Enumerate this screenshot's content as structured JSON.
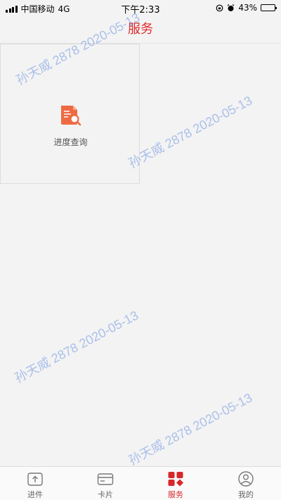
{
  "status_bar": {
    "carrier": "中国移动",
    "network": "4G",
    "time": "下午2:33",
    "battery": "43%",
    "battery_level": 0.43
  },
  "header": {
    "title": "服务"
  },
  "services": [
    {
      "label": "进度查询",
      "icon": "progress-search-icon"
    }
  ],
  "watermark": {
    "text": "孙天威 2878 2020-05-13"
  },
  "tabbar": {
    "tabs": [
      {
        "label": "进件",
        "icon": "upload-box-icon"
      },
      {
        "label": "卡片",
        "icon": "card-icon"
      },
      {
        "label": "服务",
        "icon": "grid-diamond-icon",
        "active": true
      },
      {
        "label": "我的",
        "icon": "user-circle-icon"
      }
    ]
  },
  "colors": {
    "accent": "#e02a2a",
    "tile_icon": "#ee6a43"
  }
}
